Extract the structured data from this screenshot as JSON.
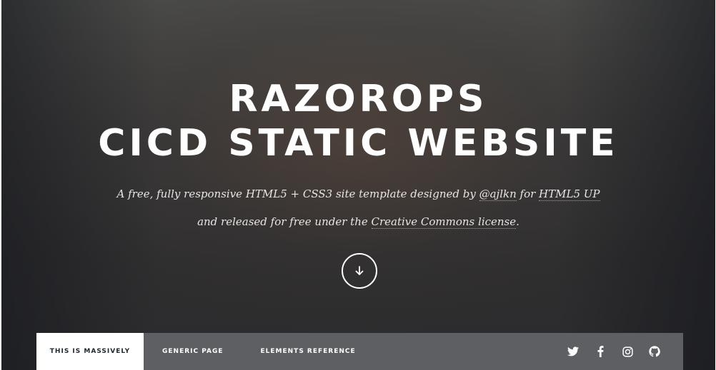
{
  "hero": {
    "title_line1": "RAZOROPS",
    "title_line2": "CICD STATIC WEBSITE",
    "tagline_line1_prefix": "A free, fully responsive HTML5 + CSS3 site template designed by ",
    "tagline_author_link": "@ajlkn",
    "tagline_line1_mid": " for ",
    "tagline_html5up_link": "HTML5 UP",
    "tagline_line2_prefix": "and released for free under the ",
    "tagline_license_link": "Creative Commons license",
    "tagline_line2_suffix": ".",
    "scroll_icon": "arrow-down-icon"
  },
  "nav": {
    "items": [
      {
        "label": "THIS IS MASSIVELY",
        "active": true
      },
      {
        "label": "GENERIC PAGE",
        "active": false
      },
      {
        "label": "ELEMENTS REFERENCE",
        "active": false
      }
    ],
    "socials": [
      "twitter-icon",
      "facebook-icon",
      "instagram-icon",
      "github-icon"
    ]
  },
  "colors": {
    "nav_bg": "#5d5f62",
    "active_bg": "#ffffff",
    "active_text": "#212931",
    "text": "#ffffff"
  }
}
